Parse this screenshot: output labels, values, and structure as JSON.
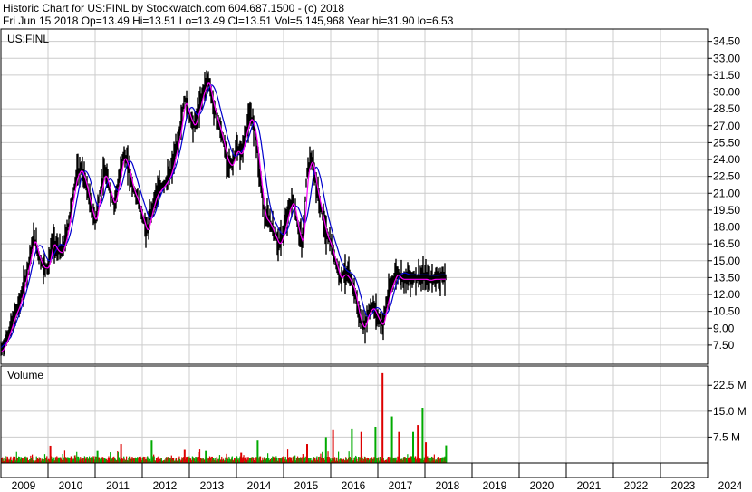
{
  "header": {
    "title": "Historic Chart for US:FINL by Stockwatch.com 604.687.1500 - (c) 2018",
    "stats": "Fri Jun 15 2018   Op=13.49   Hi=13.51   Lo=13.49   Cl=13.51   Vol=5,145,968   Year hi=31.90   lo=6.53"
  },
  "colors": {
    "price_bar": "#000000",
    "ma_short": "#ff00ff",
    "ma_long": "#0000cc",
    "volume_up": "#00aa00",
    "volume_down": "#dd0000",
    "grid": "#cccccc"
  },
  "chart_data": [
    {
      "type": "line",
      "panel": "price",
      "symbol_label": "US:FINL",
      "y_ticks": [
        "34.50",
        "33.00",
        "31.50",
        "30.00",
        "28.50",
        "27.00",
        "25.50",
        "24.00",
        "22.50",
        "21.00",
        "19.50",
        "18.00",
        "16.50",
        "15.00",
        "13.50",
        "12.00",
        "10.50",
        "9.00",
        "7.50"
      ],
      "ylim": [
        5.8,
        35.6
      ],
      "xlim": [
        2009.0,
        2024.0
      ],
      "grid": true,
      "series": [
        {
          "x": [
            2009.0,
            2009.1,
            2009.2,
            2009.3,
            2009.4,
            2009.5,
            2009.6,
            2009.7,
            2009.8,
            2009.9,
            2010.0,
            2010.1,
            2010.2,
            2010.3,
            2010.4,
            2010.5,
            2010.6,
            2010.7,
            2010.8,
            2010.9,
            2011.0,
            2011.1,
            2011.2,
            2011.3,
            2011.4,
            2011.5,
            2011.6,
            2011.7,
            2011.8,
            2011.9,
            2012.0,
            2012.1,
            2012.2,
            2012.3,
            2012.4,
            2012.5,
            2012.6,
            2012.7,
            2012.8,
            2012.9,
            2013.0,
            2013.1,
            2013.2,
            2013.3,
            2013.4,
            2013.5,
            2013.6,
            2013.7,
            2013.8,
            2013.9,
            2014.0,
            2014.1,
            2014.2,
            2014.3,
            2014.4,
            2014.5,
            2014.6,
            2014.7,
            2014.8,
            2014.9,
            2015.0,
            2015.1,
            2015.2,
            2015.3,
            2015.4,
            2015.5,
            2015.6,
            2015.7,
            2015.8,
            2015.9,
            2016.0,
            2016.1,
            2016.2,
            2016.3,
            2016.4,
            2016.5,
            2016.6,
            2016.7,
            2016.8,
            2016.9,
            2017.0,
            2017.1,
            2017.2,
            2017.3,
            2017.4,
            2017.5,
            2017.6,
            2017.7,
            2017.8,
            2017.9,
            2018.0,
            2018.1,
            2018.2,
            2018.3,
            2018.45
          ],
          "values": [
            7.0,
            7.8,
            9.0,
            10.3,
            11.3,
            13.0,
            15.0,
            17.2,
            15.5,
            14.5,
            14.5,
            16.8,
            16.0,
            15.8,
            17.5,
            20.0,
            22.6,
            23.3,
            22.0,
            20.0,
            18.5,
            21.0,
            23.0,
            21.5,
            20.0,
            22.0,
            24.5,
            23.5,
            21.5,
            20.5,
            19.0,
            17.6,
            19.5,
            21.0,
            21.5,
            22.0,
            22.8,
            24.5,
            26.5,
            29.5,
            28.0,
            27.0,
            28.5,
            30.2,
            31.2,
            29.0,
            27.5,
            26.0,
            24.0,
            23.5,
            25.0,
            24.5,
            26.5,
            28.0,
            26.5,
            22.5,
            19.0,
            18.5,
            17.5,
            16.5,
            17.5,
            19.5,
            20.5,
            18.0,
            16.5,
            23.0,
            24.2,
            21.5,
            19.5,
            17.5,
            16.5,
            15.0,
            13.5,
            14.0,
            13.5,
            12.5,
            10.2,
            9.0,
            10.5,
            11.0,
            10.0,
            9.3,
            11.5,
            13.0,
            14.0,
            13.5,
            13.5,
            13.5,
            13.5,
            13.5,
            13.5,
            13.4,
            13.5,
            13.5,
            13.51
          ]
        }
      ]
    },
    {
      "type": "bar",
      "panel": "volume",
      "title": "Volume",
      "y_ticks": [
        "22.5 M",
        "15.0 M",
        "7.5 M"
      ],
      "ylim": [
        0,
        26.5
      ],
      "xlim": [
        2009.0,
        2024.0
      ],
      "grid": true,
      "x_ticks": [
        "2009",
        "2010",
        "2011",
        "2012",
        "2013",
        "2014",
        "2015",
        "2016",
        "2017",
        "2018",
        "2019",
        "2020",
        "2021",
        "2022",
        "2023",
        "2024"
      ],
      "spikes": [
        {
          "x": 2010.05,
          "value": 5.0
        },
        {
          "x": 2011.05,
          "value": 3.5
        },
        {
          "x": 2011.55,
          "value": 5.5
        },
        {
          "x": 2012.2,
          "value": 6.5
        },
        {
          "x": 2012.9,
          "value": 3.8
        },
        {
          "x": 2013.35,
          "value": 3.5
        },
        {
          "x": 2014.1,
          "value": 3.0
        },
        {
          "x": 2014.45,
          "value": 6.5
        },
        {
          "x": 2015.5,
          "value": 5.5
        },
        {
          "x": 2015.9,
          "value": 7.5
        },
        {
          "x": 2016.05,
          "value": 9.5
        },
        {
          "x": 2016.45,
          "value": 10.0
        },
        {
          "x": 2016.65,
          "value": 9.0
        },
        {
          "x": 2016.95,
          "value": 10.5
        },
        {
          "x": 2017.1,
          "value": 26.0
        },
        {
          "x": 2017.3,
          "value": 13.5
        },
        {
          "x": 2017.45,
          "value": 9.0
        },
        {
          "x": 2017.75,
          "value": 9.0
        },
        {
          "x": 2017.85,
          "value": 11.0
        },
        {
          "x": 2017.95,
          "value": 16.0
        },
        {
          "x": 2018.02,
          "value": 6.0
        },
        {
          "x": 2018.45,
          "value": 5.1
        }
      ]
    }
  ]
}
